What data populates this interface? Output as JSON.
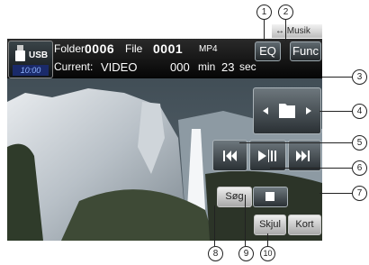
{
  "status": {
    "source": "USB",
    "clock": "10:00",
    "folder_label": "Folder",
    "folder_number": "0006",
    "file_label": "File",
    "file_number": "0001",
    "format": "MP4",
    "current_label": "Current:",
    "current_value": "VIDEO",
    "time_minutes": "000",
    "min_label": "min",
    "time_seconds": "23",
    "sec_label": "sec"
  },
  "buttons": {
    "eq": "EQ",
    "func": "Func",
    "musik": "Musik",
    "sog": "Søg",
    "skjul": "Skjul",
    "kort": "Kort"
  },
  "callouts": [
    "1",
    "2",
    "3",
    "4",
    "5",
    "6",
    "7",
    "8",
    "9",
    "10"
  ],
  "icons": [
    "usb-icon",
    "folder-prev-icon",
    "folder-icon",
    "folder-next-icon",
    "skip-back-icon",
    "skip-forward-icon",
    "play-pause-icon",
    "stop-icon",
    "swap-arrow-icon"
  ]
}
